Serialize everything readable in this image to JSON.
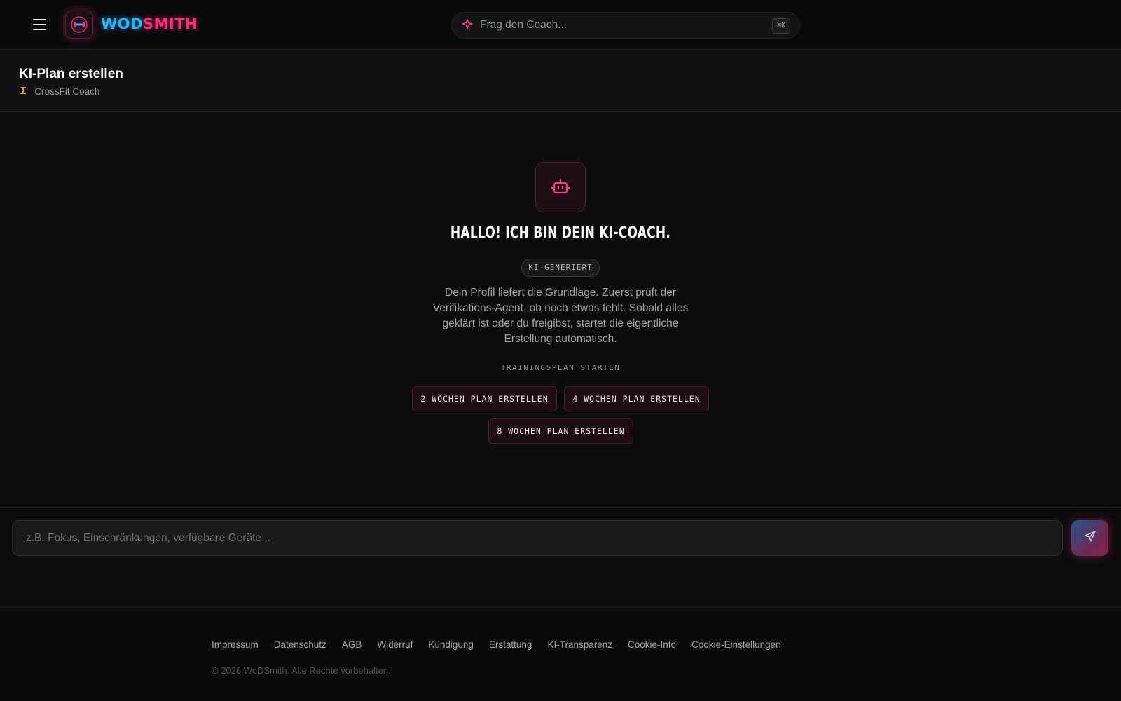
{
  "header": {
    "logo_part1": "WOD",
    "logo_part2": "SMITH",
    "search_placeholder": "Frag den Coach...",
    "search_shortcut": "⌘K"
  },
  "page": {
    "title": "KI-Plan erstellen",
    "subtitle": "CrossFit Coach"
  },
  "welcome": {
    "heading": "HALLO! ICH BIN DEIN KI-COACH.",
    "badge": "KI-GENERIERT",
    "description": "Dein Profil liefert die Grundlage. Zuerst prüft der Verifikations-Agent, ob noch etwas fehlt. Sobald alles geklärt ist oder du freigibst, startet die eigentliche Erstellung automatisch.",
    "section_label": "TRAININGSPLAN STARTEN",
    "buttons": [
      "2 WOCHEN PLAN ERSTELLEN",
      "4 WOCHEN PLAN ERSTELLEN",
      "8 WOCHEN PLAN ERSTELLEN"
    ]
  },
  "chat": {
    "placeholder": "z.B. Fokus, Einschränkungen, verfügbare Geräte..."
  },
  "footer": {
    "links": [
      "Impressum",
      "Datenschutz",
      "AGB",
      "Widerruf",
      "Kündigung",
      "Erstattung",
      "KI-Transparenz",
      "Cookie-Info",
      "Cookie-Einstellungen"
    ],
    "copyright": "© 2026 WoDSmith. Alle Rechte vorbehalten."
  },
  "colors": {
    "accent_pink": "#ff2d7a",
    "accent_blue": "#22b8ff",
    "background": "#0c0c0d"
  },
  "icons": {
    "menu": "hamburger-icon",
    "logo": "barbell-logo-icon",
    "search": "sparkle-icon",
    "subtitle": "dumbbell-icon",
    "coach": "robot-icon",
    "send": "paper-plane-icon"
  }
}
